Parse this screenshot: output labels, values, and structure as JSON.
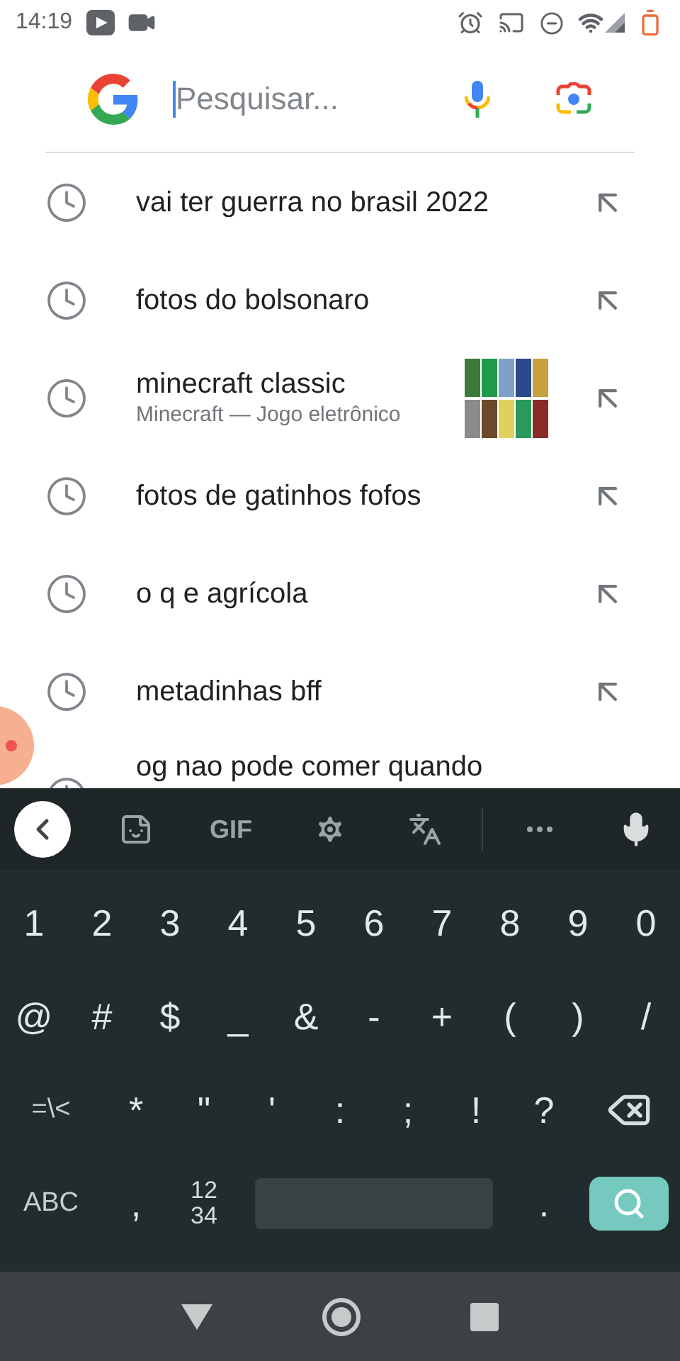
{
  "status_bar": {
    "time": "14:19"
  },
  "search": {
    "placeholder": "Pesquisar..."
  },
  "suggestions": [
    {
      "text": "vai ter guerra no brasil 2022"
    },
    {
      "text": "fotos do bolsonaro"
    },
    {
      "text": "minecraft classic",
      "subtitle": "Minecraft — Jogo eletrônico"
    },
    {
      "text": "fotos de gatinhos fofos"
    },
    {
      "text": "o q e agrícola"
    },
    {
      "text": "metadinhas bff"
    },
    {
      "text": "og nao pode comer quando"
    }
  ],
  "keyboard": {
    "toolbar": {
      "gif": "GIF"
    },
    "rows": [
      [
        {
          "kind": "char",
          "label": "1"
        },
        {
          "kind": "char",
          "label": "2"
        },
        {
          "kind": "char",
          "label": "3"
        },
        {
          "kind": "char",
          "label": "4"
        },
        {
          "kind": "char",
          "label": "5"
        },
        {
          "kind": "char",
          "label": "6"
        },
        {
          "kind": "char",
          "label": "7"
        },
        {
          "kind": "char",
          "label": "8"
        },
        {
          "kind": "char",
          "label": "9"
        },
        {
          "kind": "char",
          "label": "0"
        }
      ],
      [
        {
          "kind": "char",
          "label": "@"
        },
        {
          "kind": "char",
          "label": "#"
        },
        {
          "kind": "char",
          "label": "$"
        },
        {
          "kind": "char",
          "label": "_"
        },
        {
          "kind": "char",
          "label": "&"
        },
        {
          "kind": "char",
          "label": "-"
        },
        {
          "kind": "char",
          "label": "+"
        },
        {
          "kind": "char",
          "label": "("
        },
        {
          "kind": "char",
          "label": ")"
        },
        {
          "kind": "char",
          "label": "/"
        }
      ],
      [
        {
          "kind": "wide",
          "label": "=\\<"
        },
        {
          "kind": "char",
          "label": "*"
        },
        {
          "kind": "char",
          "label": "\""
        },
        {
          "kind": "char",
          "label": "'"
        },
        {
          "kind": "char",
          "label": ":"
        },
        {
          "kind": "char",
          "label": ";"
        },
        {
          "kind": "char",
          "label": "!"
        },
        {
          "kind": "char",
          "label": "?"
        },
        {
          "kind": "backspace"
        }
      ],
      [
        {
          "kind": "wide",
          "label": "ABC"
        },
        {
          "kind": "char",
          "label": ","
        },
        {
          "kind": "numbers",
          "lines": [
            "12",
            "34"
          ]
        },
        {
          "kind": "space"
        },
        {
          "kind": "char",
          "label": "."
        },
        {
          "kind": "search"
        }
      ]
    ]
  }
}
